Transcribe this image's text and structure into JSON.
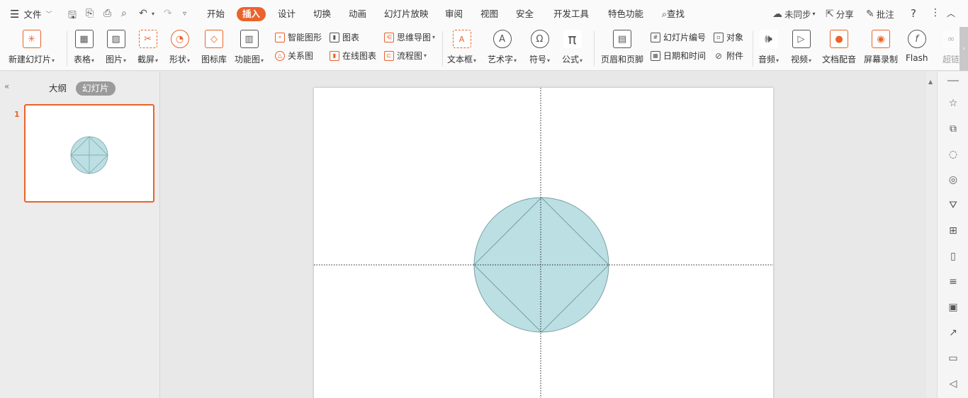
{
  "menu": {
    "file": "文件",
    "tabs": [
      "开始",
      "插入",
      "设计",
      "切换",
      "动画",
      "幻灯片放映",
      "审阅",
      "视图",
      "安全",
      "开发工具",
      "特色功能"
    ],
    "active_tab": "插入",
    "search": "查找",
    "sync": "未同步",
    "share": "分享",
    "comment": "批注",
    "help": "?"
  },
  "ribbon": {
    "new_slide": "新建幻灯片",
    "table": "表格",
    "picture": "图片",
    "screenshot": "截屏",
    "shape": "形状",
    "icon_lib": "图标库",
    "func_chart": "功能图",
    "smart_art": "智能图形",
    "chart": "图表",
    "relation": "关系图",
    "online_chart": "在线图表",
    "mindmap": "思维导图",
    "flowchart": "流程图",
    "textbox": "文本框",
    "wordart": "艺术字",
    "symbol": "符号",
    "formula": "公式",
    "header_footer": "页眉和页脚",
    "slide_number": "幻灯片编号",
    "object": "对象",
    "datetime": "日期和时间",
    "attachment": "附件",
    "audio": "音频",
    "video": "视频",
    "doc_dub": "文档配音",
    "screen_rec": "屏幕录制",
    "flash": "Flash",
    "hyperlink": "超链"
  },
  "panel": {
    "outline": "大纲",
    "slides": "幻灯片",
    "slide_number": "1"
  },
  "colors": {
    "accent": "#e9632c",
    "circle_fill": "#bbdfe3",
    "circle_stroke": "#7aa0a5"
  }
}
